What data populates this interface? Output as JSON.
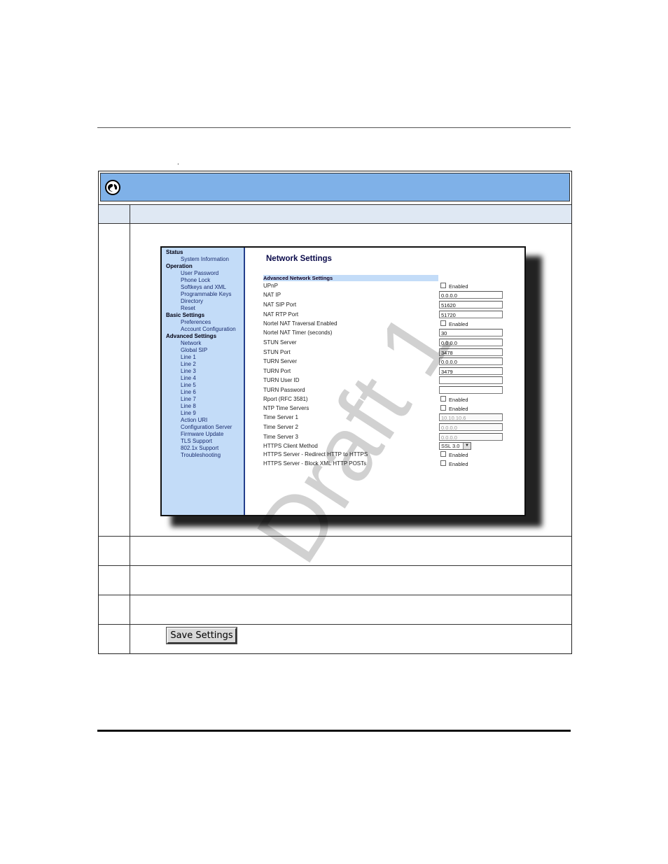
{
  "page": {
    "dot": "."
  },
  "sidebar": {
    "items": [
      {
        "type": "sec",
        "label": "Status"
      },
      {
        "type": "item",
        "label": "System Information"
      },
      {
        "type": "sec",
        "label": "Operation"
      },
      {
        "type": "item",
        "label": "User Password"
      },
      {
        "type": "item",
        "label": "Phone Lock"
      },
      {
        "type": "item",
        "label": "Softkeys and XML"
      },
      {
        "type": "item",
        "label": "Programmable Keys"
      },
      {
        "type": "item",
        "label": "Directory"
      },
      {
        "type": "item",
        "label": "Reset"
      },
      {
        "type": "sec",
        "label": "Basic Settings"
      },
      {
        "type": "item",
        "label": "Preferences"
      },
      {
        "type": "item",
        "label": "Account Configuration"
      },
      {
        "type": "sec",
        "label": "Advanced Settings"
      },
      {
        "type": "item",
        "label": "Network"
      },
      {
        "type": "item",
        "label": "Global SIP"
      },
      {
        "type": "item",
        "label": "Line 1"
      },
      {
        "type": "item",
        "label": "Line 2"
      },
      {
        "type": "item",
        "label": "Line 3"
      },
      {
        "type": "item",
        "label": "Line 4"
      },
      {
        "type": "item",
        "label": "Line 5"
      },
      {
        "type": "item",
        "label": "Line 6"
      },
      {
        "type": "item",
        "label": "Line 7"
      },
      {
        "type": "item",
        "label": "Line 8"
      },
      {
        "type": "item",
        "label": "Line 9"
      },
      {
        "type": "item",
        "label": "Action URI"
      },
      {
        "type": "item",
        "label": "Configuration Server"
      },
      {
        "type": "item",
        "label": "Firmware Update"
      },
      {
        "type": "item",
        "label": "TLS Support"
      },
      {
        "type": "item",
        "label": "802.1x Support"
      },
      {
        "type": "item",
        "label": "Troubleshooting"
      }
    ]
  },
  "main": {
    "title": "Network Settings",
    "section": "Advanced Network Settings",
    "rows": [
      {
        "label": "UPnP",
        "kind": "check",
        "text": "Enabled"
      },
      {
        "label": "NAT IP",
        "kind": "input",
        "value": "0.0.0.0"
      },
      {
        "label": "NAT SIP Port",
        "kind": "input",
        "value": "51620"
      },
      {
        "label": "NAT RTP Port",
        "kind": "input",
        "value": "51720"
      },
      {
        "label": "Nortel NAT Traversal Enabled",
        "kind": "check",
        "text": "Enabled"
      },
      {
        "label": "Nortel NAT Timer (seconds)",
        "kind": "input",
        "value": "30"
      },
      {
        "label": "STUN Server",
        "kind": "input",
        "value": "0.0.0.0"
      },
      {
        "label": "STUN Port",
        "kind": "input",
        "value": "3478"
      },
      {
        "label": "TURN Server",
        "kind": "input",
        "value": "0.0.0.0"
      },
      {
        "label": "TURN Port",
        "kind": "input",
        "value": "3479"
      },
      {
        "label": "TURN User ID",
        "kind": "input",
        "value": ""
      },
      {
        "label": "TURN Password",
        "kind": "input",
        "value": ""
      },
      {
        "label": "Rport (RFC 3581)",
        "kind": "check",
        "text": "Enabled"
      },
      {
        "label": "NTP Time Servers",
        "kind": "check",
        "text": "Enabled"
      },
      {
        "label": "Time Server 1",
        "kind": "input_dis",
        "value": "10.10.10.6"
      },
      {
        "label": "Time Server 2",
        "kind": "input_dis",
        "value": "0.0.0.0"
      },
      {
        "label": "Time Server 3",
        "kind": "input_dis",
        "value": "0.0.0.0"
      },
      {
        "label": "HTTPS Client Method",
        "kind": "select",
        "value": "SSL 3.0"
      },
      {
        "label": "HTTPS Server - Redirect HTTP to HTTPS",
        "kind": "check",
        "text": "Enabled"
      },
      {
        "label": "HTTPS Server - Block XML HTTP POSTs",
        "kind": "check",
        "text": "Enabled"
      }
    ]
  },
  "save_button": "Save Settings",
  "watermark": "Draft 1",
  "icons": {
    "header": "globe-icon"
  },
  "colors": {
    "header_bg": "#7fb1e8",
    "sidebar_bg": "#c3dcf8"
  }
}
